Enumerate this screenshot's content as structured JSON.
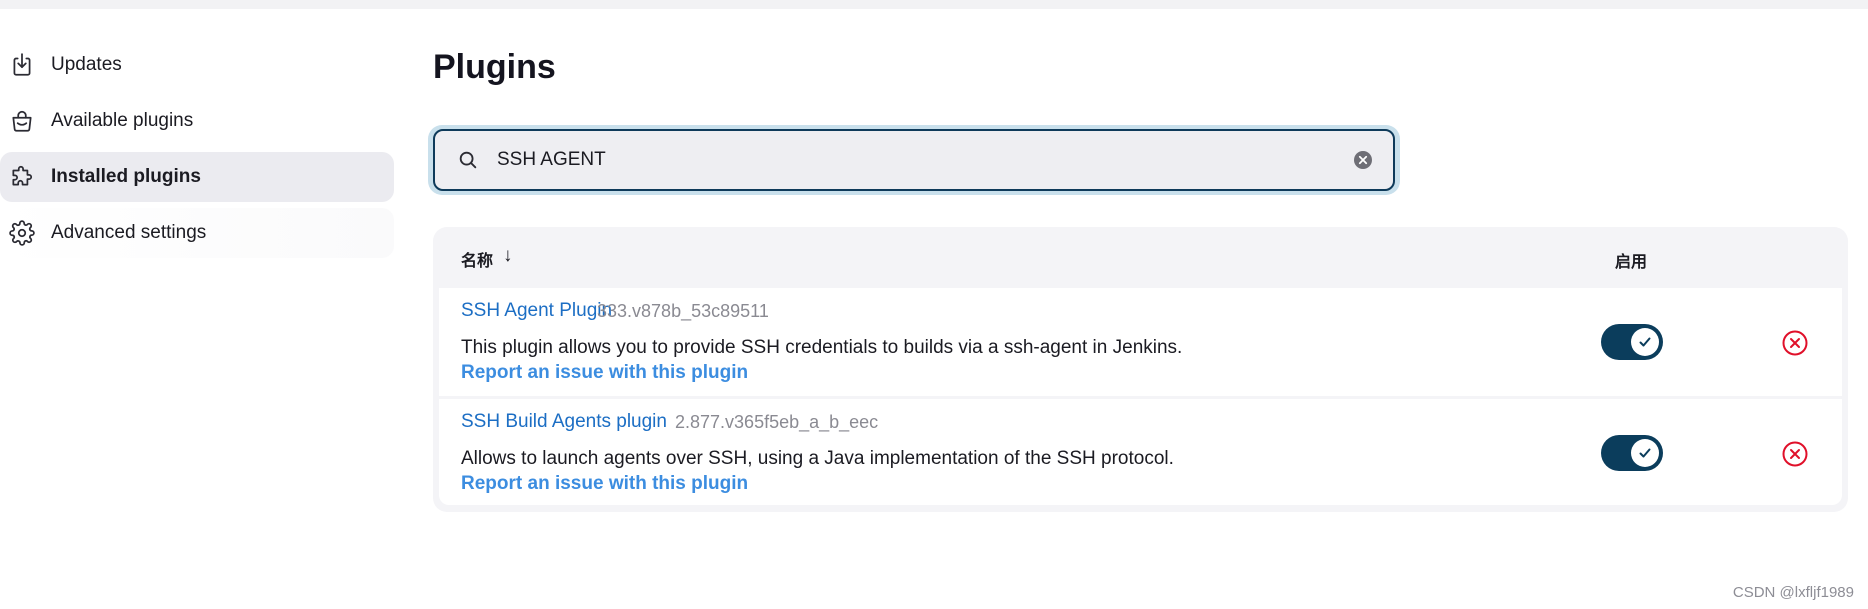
{
  "sidebar": {
    "items": [
      {
        "label": "Updates",
        "icon": "download-icon"
      },
      {
        "label": "Available plugins",
        "icon": "shopping-bag-icon"
      },
      {
        "label": "Installed plugins",
        "icon": "puzzle-icon",
        "active": true
      },
      {
        "label": "Advanced settings",
        "icon": "gear-icon"
      }
    ]
  },
  "main": {
    "title": "Plugins",
    "search": {
      "value": "SSH AGENT",
      "icon": "search-icon",
      "clear_icon": "clear-icon"
    },
    "table": {
      "columns": {
        "name": "名称",
        "sort": "↓",
        "enabled": "启用"
      },
      "rows": [
        {
          "name": "SSH Agent Plugin",
          "version": "333.v878b_53c89511",
          "description": "This plugin allows you to provide SSH credentials to builds via a ssh-agent in Jenkins.",
          "report": "Report an issue with this plugin",
          "enabled": true
        },
        {
          "name": "SSH Build Agents plugin",
          "version": "2.877.v365f5eb_a_b_eec",
          "description": "Allows to launch agents over SSH, using a Java implementation of the SSH protocol.",
          "report": "Report an issue with this plugin",
          "enabled": true
        }
      ]
    }
  },
  "watermark": "CSDN @lxfljf1989",
  "colors": {
    "link": "#1c6ec4",
    "report_link": "#3c8de0",
    "toggle_on": "#0b3d5c",
    "uninstall": "#e0102a",
    "active_nav_bg": "#ebebf0"
  }
}
